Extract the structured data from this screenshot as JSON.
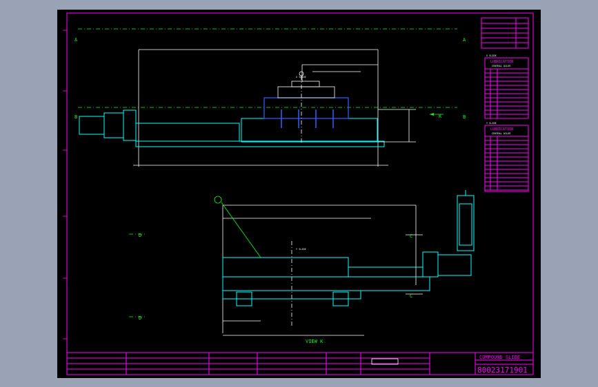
{
  "sheet": {
    "section_labels": {
      "a_left": "A",
      "a_right": "A",
      "b_left": "B",
      "b_right": "B",
      "k": "K",
      "c_top": "C",
      "c_bottom": "C",
      "d_top": "D",
      "d_bottom": "D"
    },
    "view_label": "VIEW K",
    "slide_labels": {
      "x_slide": "X SLIDE",
      "y_slide": "Y SLIDE"
    }
  },
  "lubrication_tables": [
    {
      "axis": "X SLIDE",
      "title": "LUBRICATION",
      "subtitle": "CENTRAL OILER",
      "rows": 12
    },
    {
      "axis": "Y SLIDE",
      "title": "LUBRICATION",
      "subtitle": "CENTRAL OILER",
      "rows": 13
    }
  ],
  "title_block": {
    "title": "COMPOUND SLIDE",
    "drawing_number": "80023171901"
  }
}
